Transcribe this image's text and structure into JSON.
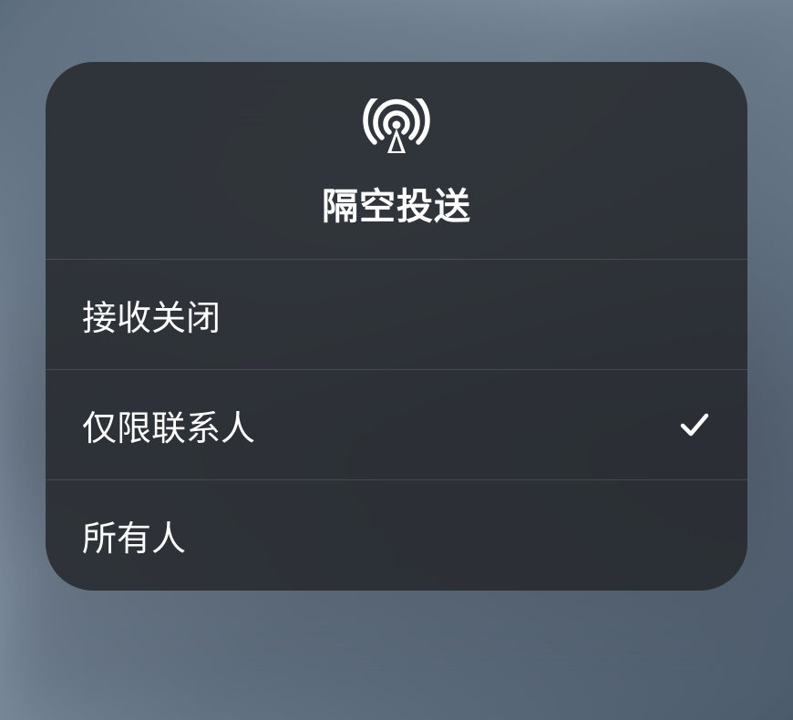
{
  "header": {
    "title": "隔空投送",
    "icon_name": "airdrop"
  },
  "options": [
    {
      "label": "接收关闭",
      "selected": false
    },
    {
      "label": "仅限联系人",
      "selected": true
    },
    {
      "label": "所有人",
      "selected": false
    }
  ]
}
